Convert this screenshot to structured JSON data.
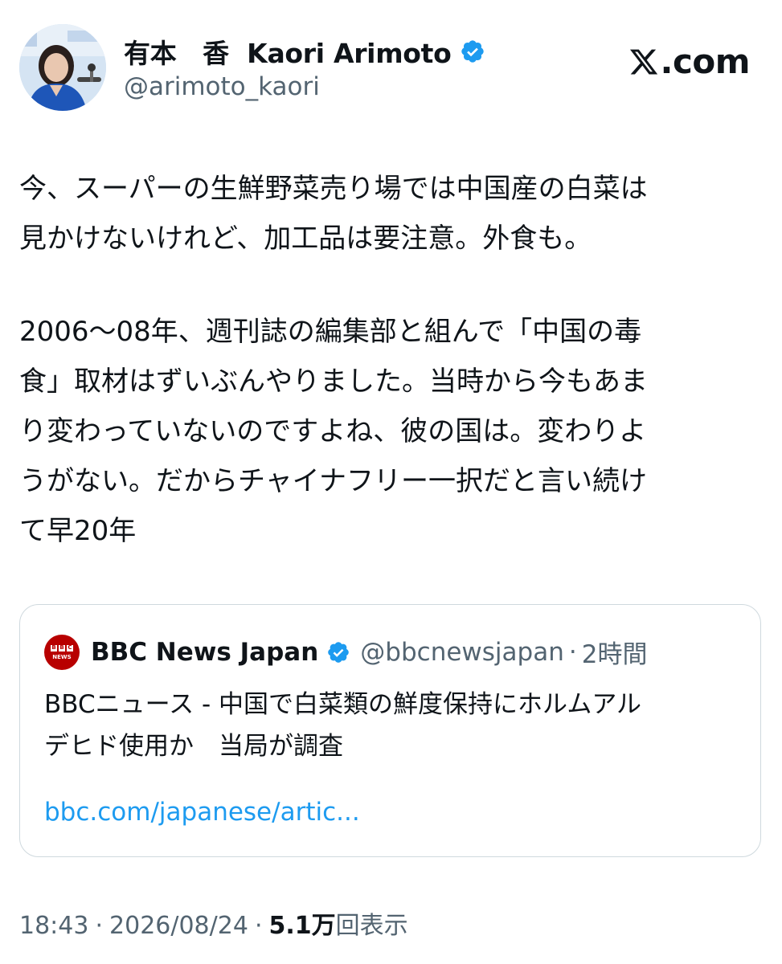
{
  "author": {
    "display_name": "有本　香  Kaori Arimoto",
    "handle": "@arimoto_kaori",
    "avatar_icon": "author-photo"
  },
  "brand": {
    "logo_text": ".com",
    "logo_icon": "x-logo-icon"
  },
  "tweet": {
    "paragraphs": [
      [
        "今、スーパーの生鮮野菜売り場では中国産の白菜は",
        "見かけないけれど、加工品は要注意。外食も。"
      ],
      [
        "2006〜08年、週刊誌の編集部と組んで「中国の毒",
        "食」取材はずいぶんやりました。当時から今もあま",
        "り変わっていないのですよね、彼の国は。変わりよ",
        "うがない。だからチャイナフリー一択だと言い続け",
        "て早20年"
      ]
    ]
  },
  "quoted_post": {
    "account_name": "BBC News Japan",
    "handle": "@bbcnewsjapan",
    "separator": "·",
    "time": "2時間",
    "logo_text": "BBC",
    "logo_sub": "NEWS",
    "text_lines": [
      "BBCニュース - 中国で白菜類の鮮度保持にホルムアル",
      "デヒド使用か　当局が調査"
    ],
    "link": "bbc.com/japanese/artic..."
  },
  "meta": {
    "time": "18:43",
    "separator": "·",
    "date": "2026/08/24",
    "views_count": "5.1万",
    "views_label": "回表示"
  },
  "colors": {
    "text": "#0f1419",
    "secondary": "#536471",
    "link": "#1d9bf0",
    "verified": "#1d9bf0",
    "border": "#cfd9de",
    "bbc_red": "#b80000"
  }
}
